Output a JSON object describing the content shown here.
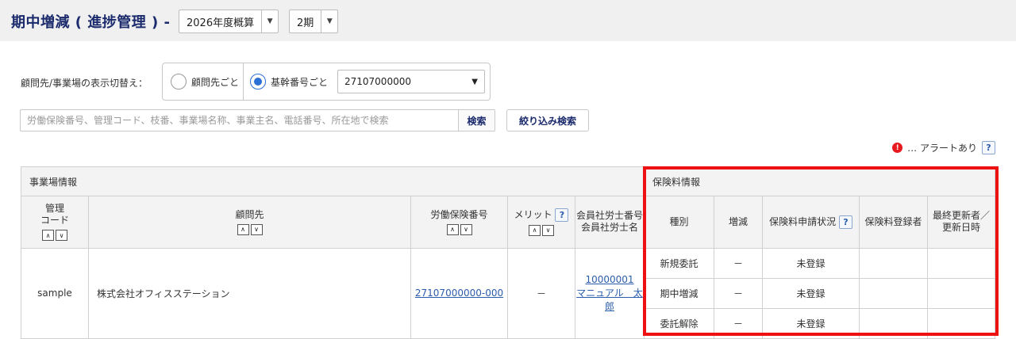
{
  "page": {
    "title": "期中増減 ( 進捗管理 ) -",
    "year_select": "2026年度概算",
    "period_select": "2期"
  },
  "display_switch": {
    "label": "顧問先/事業場の表示切替え：",
    "option_client": "顧問先ごと",
    "option_base_number": "基幹番号ごと",
    "selected_base_number": "27107000000"
  },
  "search": {
    "placeholder": "労働保険番号、管理コード、枝番、事業場名称、事業主名、電話番号、所在地で検索",
    "search_button": "検索",
    "filter_button": "絞り込み検索"
  },
  "alert_legend": {
    "text": "… アラートあり",
    "icon": "!",
    "help": "?"
  },
  "table": {
    "section_business": "事業場情報",
    "section_premium": "保険料情報",
    "col_code": "管理\nコード",
    "col_client": "顧問先",
    "col_insurance_no": "労働保険番号",
    "col_merit": "メリット",
    "col_sharoushi": "会員社労士番号\n会員社労士名",
    "col_type": "種別",
    "col_change": "増減",
    "col_status": "保険料申請状況",
    "col_registrant": "保険料登録者",
    "col_updated": "最終更新者／\n更新日時",
    "help": "?",
    "sort_up": "∧",
    "sort_down": "∨",
    "row": {
      "code": "sample",
      "client": "株式会社オフィスステーション",
      "insurance_no": "27107000000-000",
      "merit": "－",
      "sharoushi_no": "10000001",
      "sharoushi_name": "マニュアル　太郎",
      "items": [
        {
          "type": "新規委託",
          "change": "－",
          "status": "未登録"
        },
        {
          "type": "期中増減",
          "change": "－",
          "status": "未登録"
        },
        {
          "type": "委託解除",
          "change": "－",
          "status": "未登録"
        }
      ]
    }
  },
  "colors": {
    "title": "#1a2a6c",
    "link": "#2b5cab",
    "alert_red": "#e8191f",
    "highlight_box": "#ee1111"
  }
}
